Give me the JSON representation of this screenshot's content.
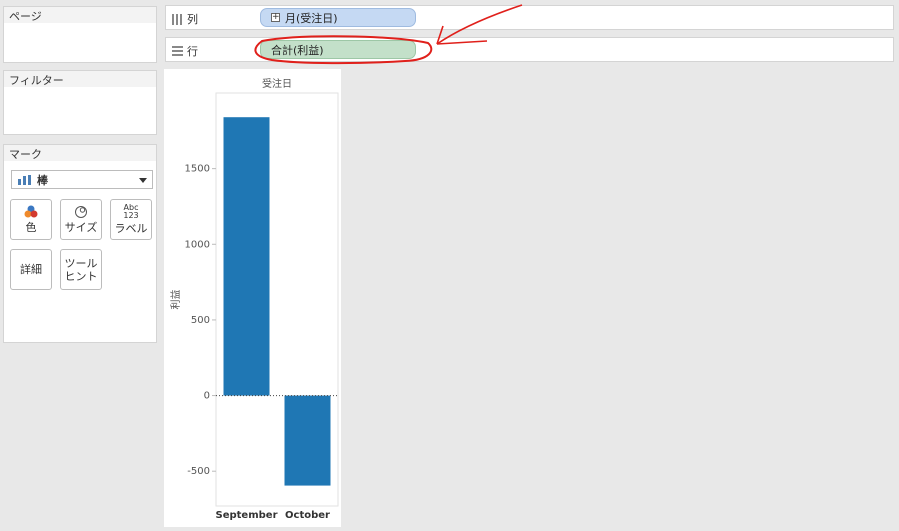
{
  "panels": {
    "pages": {
      "title": "ページ"
    },
    "filters": {
      "title": "フィルター"
    },
    "marks": {
      "title": "マーク",
      "mark_type": "棒",
      "buttons": {
        "color": "色",
        "size": "サイズ",
        "label": "ラベル",
        "label_icon_top": "Abc",
        "label_icon_bottom": "123",
        "detail": "詳細",
        "tooltip_line1": "ツール",
        "tooltip_line2": "ヒント"
      }
    }
  },
  "shelves": {
    "columns": {
      "label": "列",
      "pill": "月(受注日)"
    },
    "rows": {
      "label": "行",
      "pill": "合計(利益)"
    }
  },
  "colors": {
    "bar": "#1f77b4",
    "columns_pill": "#c5d9f3",
    "rows_pill": "#c3e0c9",
    "annotation": "#e0201b"
  },
  "chart_data": {
    "type": "bar",
    "title": "受注日",
    "xlabel": "",
    "ylabel": "利益",
    "categories": [
      "September",
      "October"
    ],
    "values": [
      1840,
      -595
    ],
    "ylim": [
      -730,
      2000
    ],
    "yticks": [
      -500,
      0,
      500,
      1000,
      1500
    ],
    "grid": false,
    "zero_line": "dotted"
  }
}
